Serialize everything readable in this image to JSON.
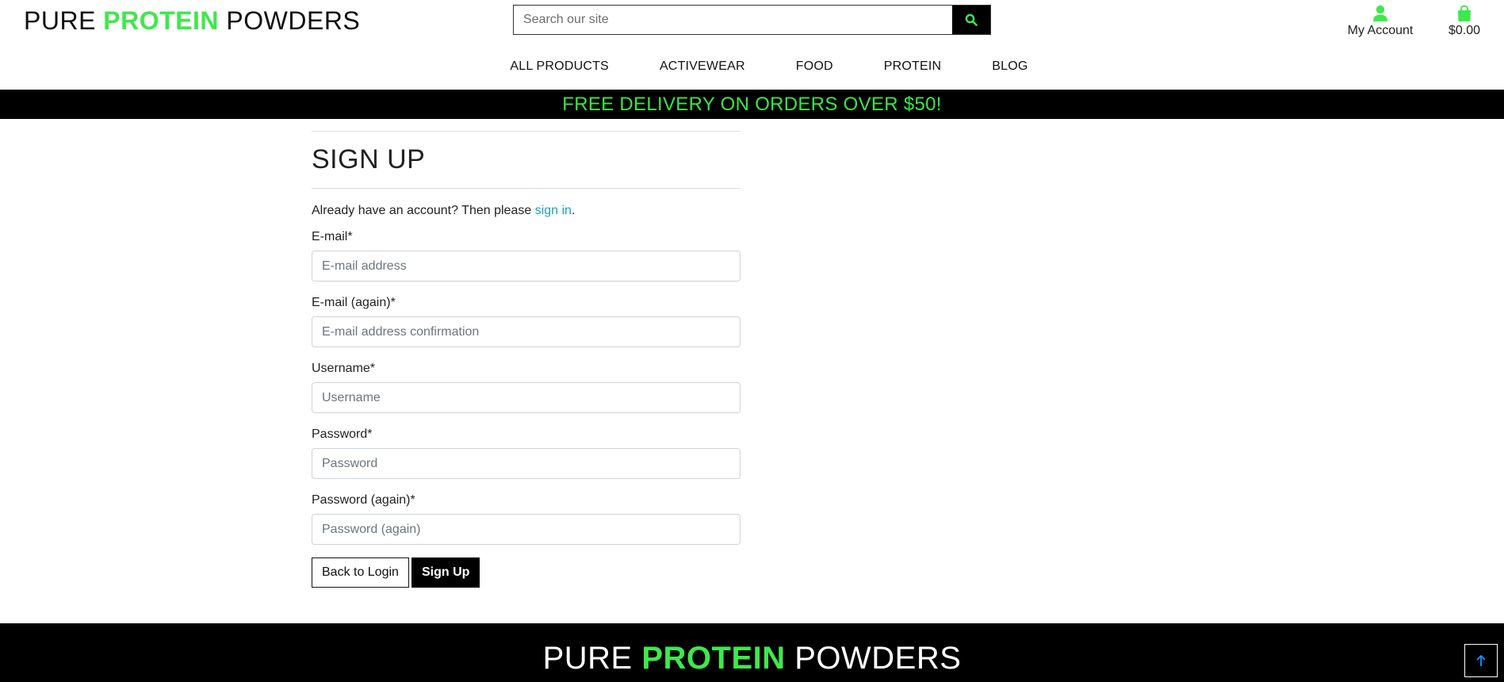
{
  "header": {
    "logo": {
      "part1": "PURE ",
      "part2": "PROTEIN",
      "part3": " POWDERS"
    },
    "search": {
      "placeholder": "Search our site"
    },
    "account_label": "My Account",
    "bag_total": "$0.00"
  },
  "nav": {
    "items": [
      {
        "label": "ALL PRODUCTS"
      },
      {
        "label": "ACTIVEWEAR"
      },
      {
        "label": "FOOD"
      },
      {
        "label": "PROTEIN"
      },
      {
        "label": "BLOG"
      }
    ]
  },
  "banner": {
    "text": "FREE DELIVERY ON ORDERS OVER $50!"
  },
  "signup": {
    "title": "SIGN UP",
    "intro_prefix": "Already have an account? Then please ",
    "intro_link": "sign in",
    "intro_suffix": ".",
    "fields": [
      {
        "label": "E-mail*",
        "placeholder": "E-mail address"
      },
      {
        "label": "E-mail (again)*",
        "placeholder": "E-mail address confirmation"
      },
      {
        "label": "Username*",
        "placeholder": "Username"
      },
      {
        "label": "Password*",
        "placeholder": "Password"
      },
      {
        "label": "Password (again)*",
        "placeholder": "Password (again)"
      }
    ],
    "back_button": "Back to Login",
    "submit_button": "Sign Up"
  },
  "footer": {
    "logo": {
      "part1": "PURE ",
      "part2": "PROTEIN",
      "part3": " POWDERS"
    }
  },
  "colors": {
    "accent_green": "#3fe84c",
    "link_blue": "#17a2b8",
    "black": "#000000"
  },
  "icons": {
    "search": "search-icon",
    "account": "user-icon",
    "bag": "shopping-bag-icon",
    "back_to_top": "arrow-up-icon"
  }
}
